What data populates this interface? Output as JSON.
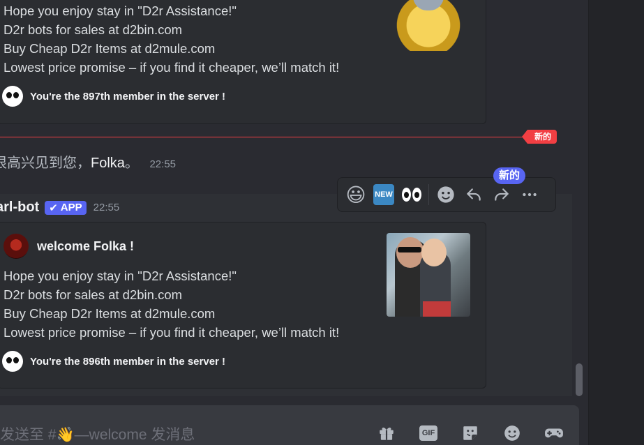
{
  "embed_top": {
    "lines": [
      "Hope you enjoy stay in \"D2r Assistance!\"",
      "D2r bots for sales at d2bin.com",
      "Buy Cheap D2r Items at d2mule.com",
      "Lowest price promise – if you find it cheaper, we’ll match it!"
    ],
    "footer": "You're the 897th member in the server !"
  },
  "divider": {
    "new_label": "新的"
  },
  "system_message": {
    "prefix": "很高兴见到您，",
    "name": "Folka",
    "suffix": "。",
    "time": "22:55"
  },
  "bot_message": {
    "author": "arl-bot",
    "badge": "APP",
    "time": "22:55",
    "embed": {
      "title": "welcome Folka !",
      "lines": [
        "Hope you enjoy stay in \"D2r Assistance!\"",
        "D2r bots for sales at d2bin.com",
        "Buy Cheap D2r Items at d2mule.com",
        "Lowest price promise – if you find it cheaper, we’ll match it!"
      ],
      "footer": "You're the 896th member in the server !"
    }
  },
  "toolbar": {
    "reaction_1": "😃",
    "reaction_2": "NEW",
    "new_bubble": "新的",
    "icons": [
      "grinning-emoji-icon",
      "new-button-emoji-icon",
      "eyes-emoji-icon",
      "add-reaction-icon",
      "reply-icon",
      "forward-icon",
      "more-icon"
    ]
  },
  "composer": {
    "placeholder": "发送至 #👋—welcome 发消息",
    "gif_label": "GIF",
    "icons": [
      "gift-icon",
      "gif-icon",
      "sticker-icon",
      "emoji-icon",
      "apps-icon"
    ]
  }
}
